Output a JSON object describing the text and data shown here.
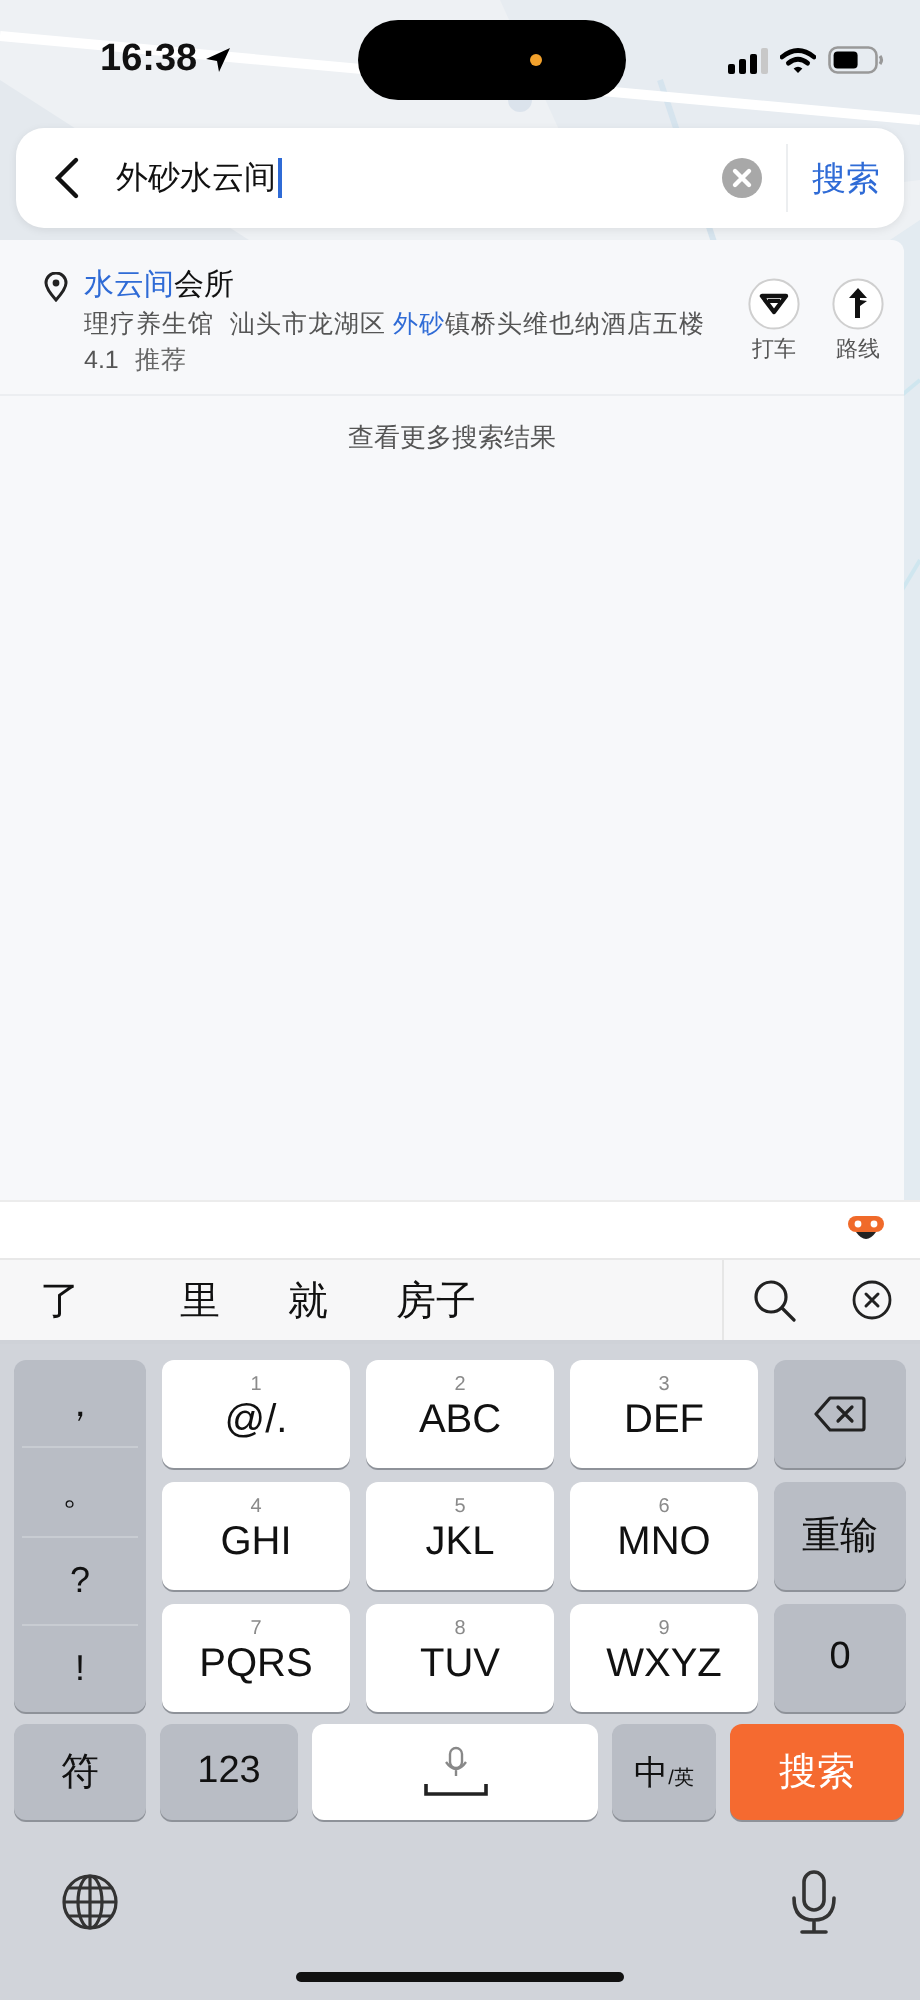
{
  "status_bar": {
    "time": "16:38"
  },
  "search": {
    "value": "外砂水云间",
    "button": "搜索"
  },
  "results": [
    {
      "title_parts": [
        {
          "text": "水云间",
          "highlight": true
        },
        {
          "text": "会所",
          "highlight": false
        }
      ],
      "category": "理疗养生馆",
      "address_parts": [
        {
          "text": "汕头市龙湖区 ",
          "highlight": false
        },
        {
          "text": "外砂",
          "highlight": true
        },
        {
          "text": "镇桥头维也纳酒店五楼",
          "highlight": false
        }
      ],
      "rating": "4.1",
      "tag": "推荐",
      "actions": [
        {
          "kind": "taxi",
          "label": "打车"
        },
        {
          "kind": "route",
          "label": "路线"
        }
      ]
    }
  ],
  "more_link": "查看更多搜索结果",
  "candidates": [
    "了",
    "里",
    "就",
    "房子"
  ],
  "keyboard": {
    "symbol_keys": [
      "，",
      "。",
      "?",
      "!"
    ],
    "letter_keys": [
      {
        "digit": "1",
        "letters": "@/."
      },
      {
        "digit": "2",
        "letters": "ABC"
      },
      {
        "digit": "3",
        "letters": "DEF"
      },
      {
        "digit": "4",
        "letters": "GHI"
      },
      {
        "digit": "5",
        "letters": "JKL"
      },
      {
        "digit": "6",
        "letters": "MNO"
      },
      {
        "digit": "7",
        "letters": "PQRS"
      },
      {
        "digit": "8",
        "letters": "TUV"
      },
      {
        "digit": "9",
        "letters": "WXYZ"
      }
    ],
    "side_keys": [
      {
        "kind": "delete"
      },
      {
        "kind": "text",
        "label": "重输"
      },
      {
        "kind": "text",
        "label": "0"
      }
    ],
    "bottom_row": [
      {
        "kind": "key",
        "label": "符"
      },
      {
        "kind": "key",
        "label": "123"
      },
      {
        "kind": "space"
      },
      {
        "kind": "lang",
        "label": "中",
        "sub": "/英"
      },
      {
        "kind": "action",
        "label": "搜索"
      }
    ]
  }
}
